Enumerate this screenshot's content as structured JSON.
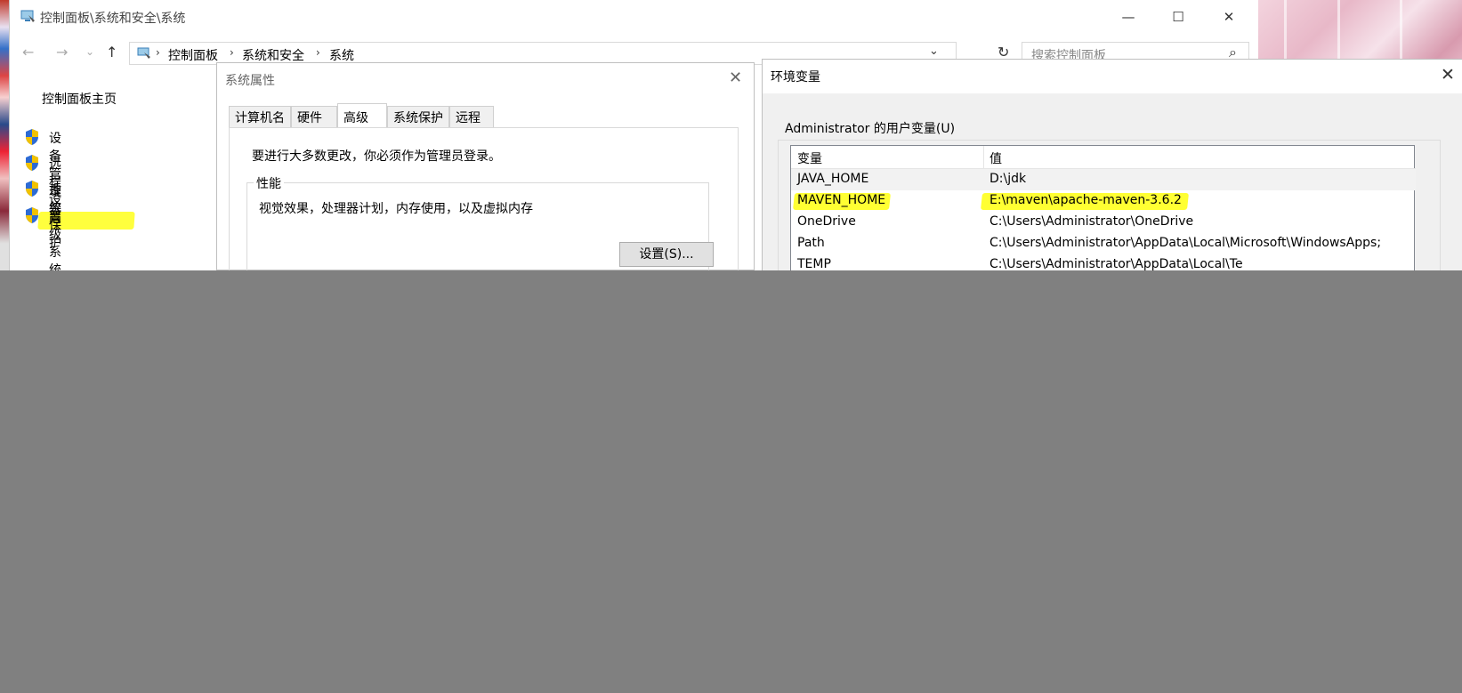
{
  "control_panel": {
    "title": "控制面板\\系统和安全\\系统",
    "buttons": {
      "minimize": "—",
      "maximize": "☐",
      "close": "✕"
    },
    "nav": {
      "back": "←",
      "forward": "→",
      "dropdown": "⌄",
      "up": "↑"
    },
    "breadcrumb": [
      "控制面板",
      "系统和安全",
      "系统"
    ],
    "breadcrumb_sep": "›",
    "address_dropdown": "⌄",
    "refresh": "↻",
    "search_placeholder": "搜索控制面板",
    "search_icon": "⌕",
    "sidebar": {
      "home": "控制面板主页",
      "items": [
        {
          "label": "设备管理器",
          "icon": "uac-shield-icon"
        },
        {
          "label": "远程设置",
          "icon": "uac-shield-icon"
        },
        {
          "label": "系统保护",
          "icon": "uac-shield-icon"
        },
        {
          "label": "高级系统设置",
          "icon": "uac-shield-icon",
          "highlighted": true
        }
      ]
    }
  },
  "system_properties": {
    "title": "系统属性",
    "close": "✕",
    "tabs": [
      "计算机名",
      "硬件",
      "高级",
      "系统保护",
      "远程"
    ],
    "active_tab": "高级",
    "admin_notice": "要进行大多数更改，你必须作为管理员登录。",
    "performance": {
      "label": "性能",
      "description": "视觉效果，处理器计划，内存使用，以及虚拟内存",
      "button": "设置(S)..."
    }
  },
  "environment_variables": {
    "title": "环境变量",
    "close": "✕",
    "user_group_label": "Administrator 的用户变量(U)",
    "columns": [
      "变量",
      "值"
    ],
    "rows": [
      {
        "name": "JAVA_HOME",
        "value": "D:\\jdk"
      },
      {
        "name": "MAVEN_HOME",
        "value": "E:\\maven\\apache-maven-3.6.2"
      },
      {
        "name": "OneDrive",
        "value": "C:\\Users\\Administrator\\OneDrive"
      },
      {
        "name": "Path",
        "value": "C:\\Users\\Administrator\\AppData\\Local\\Microsoft\\WindowsApps;"
      },
      {
        "name": "TEMP",
        "value": "C:\\Users\\Administrator\\AppData\\Local\\Te"
      }
    ]
  },
  "colors": {
    "highlight": "#ffff33",
    "shield_blue": "#2d6bd4",
    "shield_yellow": "#f2c200",
    "overlay_gray": "#808080"
  }
}
